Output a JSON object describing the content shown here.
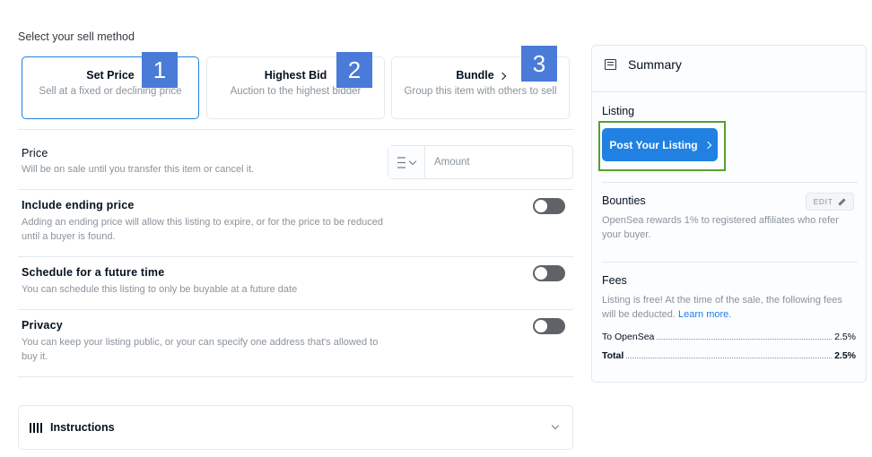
{
  "sell_method": {
    "heading": "Select your sell method",
    "options": [
      {
        "title": "Set Price",
        "subtitle": "Sell at a fixed or declining price",
        "selected": true,
        "badge": "1"
      },
      {
        "title": "Highest Bid",
        "subtitle": "Auction to the highest bidder",
        "selected": false,
        "badge": "2"
      },
      {
        "title": "Bundle",
        "subtitle": "Group this item with others to sell",
        "selected": false,
        "badge": "3"
      }
    ]
  },
  "price": {
    "title": "Price",
    "description": "Will be on sale until you transfer this item or cancel it.",
    "currency_icon": "ethereum-icon",
    "amount_placeholder": "Amount"
  },
  "options": [
    {
      "title": "Include ending price",
      "description": "Adding an ending price will allow this listing to expire, or for the price to be reduced until a buyer is found.",
      "enabled": false
    },
    {
      "title": "Schedule for a future time",
      "description": "You can schedule this listing to only be buyable at a future date",
      "enabled": false
    },
    {
      "title": "Privacy",
      "description": "You can keep your listing public, or your can specify one address that's allowed to buy it.",
      "enabled": false
    }
  ],
  "instructions": {
    "label": "Instructions"
  },
  "summary": {
    "title": "Summary",
    "listing_label": "Listing",
    "post_button": "Post Your Listing",
    "bounties_label": "Bounties",
    "edit_label": "EDIT",
    "bounties_text": "OpenSea rewards 1% to registered affiliates who refer your buyer.",
    "fees_label": "Fees",
    "fees_text": "Listing is free! At the time of the sale, the following fees will be deducted.",
    "learn_more": "Learn more.",
    "fee_rows": [
      {
        "label": "To OpenSea",
        "value": "2.5%"
      },
      {
        "label": "Total",
        "value": "2.5%"
      }
    ]
  },
  "colors": {
    "accent": "#2081e2",
    "badge": "#4a7bd8",
    "highlight_border": "#5a9e2e",
    "toggle_off": "#5f6266"
  }
}
